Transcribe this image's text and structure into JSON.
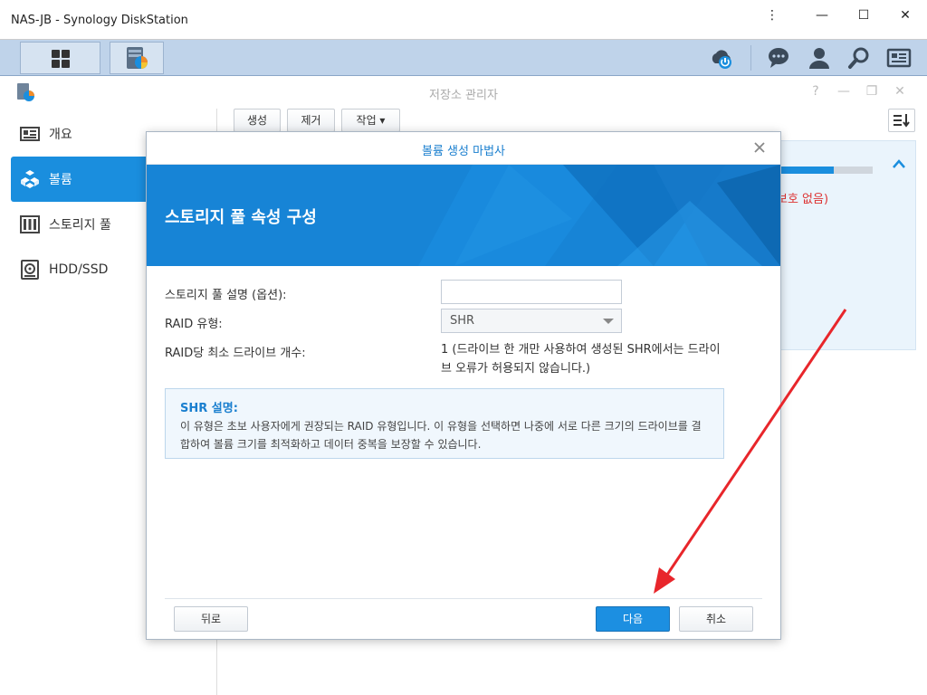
{
  "os_window": {
    "title": "NAS-JB - Synology DiskStation",
    "menu_glyph": "⋮",
    "minimize_glyph": "—",
    "maximize_glyph": "☐",
    "close_glyph": "✕"
  },
  "taskbar": {
    "apps": [
      {
        "name": "main-menu",
        "icon": "grid-icon"
      },
      {
        "name": "storage-manager",
        "icon": "storage-manager-icon"
      }
    ],
    "right_icons": [
      "cloud-power-icon",
      "chat-icon",
      "user-icon",
      "search-icon",
      "widgets-icon"
    ]
  },
  "window": {
    "title": "저장소 관리자",
    "controls": [
      "?",
      "—",
      "❐",
      "✕"
    ]
  },
  "sidebar": {
    "items": [
      {
        "label": "개요",
        "icon": "overview-icon",
        "active": false
      },
      {
        "label": "볼륨",
        "icon": "volume-icon",
        "active": true
      },
      {
        "label": "스토리지 풀",
        "icon": "storage-pool-icon",
        "active": false
      },
      {
        "label": "HDD/SSD",
        "icon": "hdd-icon",
        "active": false
      }
    ]
  },
  "toolbar": {
    "create_label": "생성",
    "remove_label": "제거",
    "action_label": "작업 ▾"
  },
  "background_panel": {
    "status_text": "보호 없음)",
    "progress_fraction": 0.58
  },
  "modal": {
    "title": "볼륨 생성 마법사",
    "banner_title": "스토리지 풀 속성 구성",
    "fields": {
      "description_label": "스토리지 풀 설명 (옵션):",
      "description_value": "",
      "raid_type_label": "RAID 유형:",
      "raid_type_value": "SHR",
      "min_drives_label": "RAID당 최소 드라이브 개수:",
      "min_drives_value": "1 (드라이브 한 개만 사용하여 생성된 SHR에서는 드라이브 오류가 허용되지 않습니다.)"
    },
    "info": {
      "title": "SHR 설명:",
      "text": "이 유형은 초보 사용자에게 권장되는 RAID 유형입니다. 이 유형을 선택하면 나중에 서로 다른 크기의 드라이브를 결합하여 볼륨 크기를 최적화하고 데이터 중복을 보장할 수 있습니다."
    },
    "buttons": {
      "back": "뒤로",
      "next": "다음",
      "cancel": "취소"
    }
  },
  "colors": {
    "accent": "#1a8ede",
    "banner": "#1784d6",
    "annotation_arrow": "#e8262b"
  }
}
